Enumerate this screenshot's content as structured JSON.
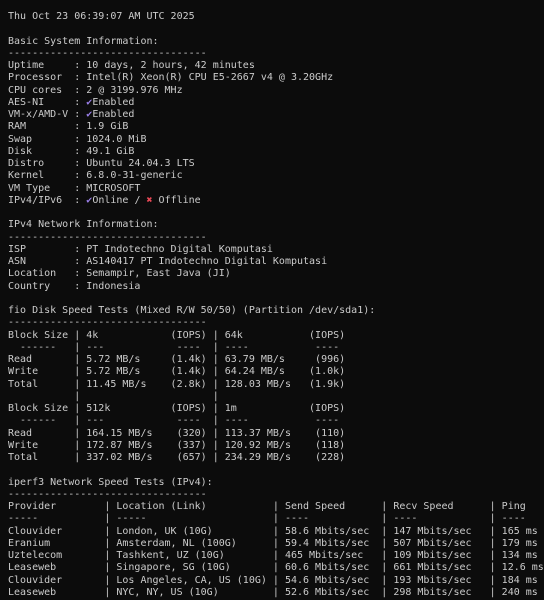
{
  "colors": {
    "background": "#0c0c0c",
    "text": "#cccccc",
    "check": "#9a7fe8",
    "cross": "#e74856"
  },
  "icons": {
    "check": "check-icon",
    "cross": "cross-icon"
  },
  "lines": [
    {
      "text": "Thu Oct 23 06:39:07 AM UTC 2025"
    },
    {
      "text": ""
    },
    {
      "text": "Basic System Information:"
    },
    {
      "text": "---------------------------------"
    },
    {
      "text": "Uptime     : 10 days, 2 hours, 42 minutes"
    },
    {
      "text": "Processor  : Intel(R) Xeon(R) CPU E5-2667 v4 @ 3.20GHz"
    },
    {
      "text": "CPU cores  : 2 @ 3199.976 MHz"
    },
    {
      "segments": [
        {
          "t": "AES-NI     : "
        },
        {
          "icon": "check"
        },
        {
          "t": "Enabled"
        }
      ]
    },
    {
      "segments": [
        {
          "t": "VM-x/AMD-V : "
        },
        {
          "icon": "check"
        },
        {
          "t": "Enabled"
        }
      ]
    },
    {
      "text": "RAM        : 1.9 GiB"
    },
    {
      "text": "Swap       : 1024.0 MiB"
    },
    {
      "text": "Disk       : 49.1 GiB"
    },
    {
      "text": "Distro     : Ubuntu 24.04.3 LTS"
    },
    {
      "text": "Kernel     : 6.8.0-31-generic"
    },
    {
      "text": "VM Type    : MICROSOFT"
    },
    {
      "segments": [
        {
          "t": "IPv4/IPv6  : "
        },
        {
          "icon": "check"
        },
        {
          "t": "Online / "
        },
        {
          "icon": "cross"
        },
        {
          "t": " Offline"
        }
      ]
    },
    {
      "text": ""
    },
    {
      "text": "IPv4 Network Information:"
    },
    {
      "text": "---------------------------------"
    },
    {
      "text": "ISP        : PT Indotechno Digital Komputasi"
    },
    {
      "text": "ASN        : AS140417 PT Indotechno Digital Komputasi"
    },
    {
      "text": "Location   : Semampir, East Java (JI)"
    },
    {
      "text": "Country    : Indonesia"
    },
    {
      "text": ""
    },
    {
      "text": "fio Disk Speed Tests (Mixed R/W 50/50) (Partition /dev/sda1):"
    },
    {
      "text": "---------------------------------"
    },
    {
      "text": "Block Size | 4k            (IOPS) | 64k           (IOPS)"
    },
    {
      "text": "  ------   | ---            ----  | ----           ----"
    },
    {
      "text": "Read       | 5.72 MB/s     (1.4k) | 63.79 MB/s     (996)"
    },
    {
      "text": "Write      | 5.72 MB/s     (1.4k) | 64.24 MB/s    (1.0k)"
    },
    {
      "text": "Total      | 11.45 MB/s    (2.8k) | 128.03 MB/s   (1.9k)"
    },
    {
      "text": "           |                      |"
    },
    {
      "text": "Block Size | 512k          (IOPS) | 1m            (IOPS)"
    },
    {
      "text": "  ------   | ---            ----  | ----           ----"
    },
    {
      "text": "Read       | 164.15 MB/s    (320) | 113.37 MB/s    (110)"
    },
    {
      "text": "Write      | 172.87 MB/s    (337) | 120.92 MB/s    (118)"
    },
    {
      "text": "Total      | 337.02 MB/s    (657) | 234.29 MB/s    (228)"
    },
    {
      "text": ""
    },
    {
      "text": "iperf3 Network Speed Tests (IPv4):"
    },
    {
      "text": "---------------------------------"
    },
    {
      "text": "Provider        | Location (Link)           | Send Speed      | Recv Speed      | Ping"
    },
    {
      "text": "-----           | -----                     | ----            | ----            | ----"
    },
    {
      "text": "Clouvider       | London, UK (10G)          | 58.6 Mbits/sec  | 147 Mbits/sec   | 165 ms"
    },
    {
      "text": "Eranium         | Amsterdam, NL (100G)      | 59.4 Mbits/sec  | 507 Mbits/sec   | 179 ms"
    },
    {
      "text": "Uztelecom       | Tashkent, UZ (10G)        | 465 Mbits/sec   | 109 Mbits/sec   | 134 ms"
    },
    {
      "text": "Leaseweb        | Singapore, SG (10G)       | 60.6 Mbits/sec  | 661 Mbits/sec   | 12.6 ms"
    },
    {
      "text": "Clouvider       | Los Angeles, CA, US (10G) | 54.6 Mbits/sec  | 193 Mbits/sec   | 184 ms"
    },
    {
      "text": "Leaseweb        | NYC, NY, US (10G)         | 52.6 Mbits/sec  | 298 Mbits/sec   | 240 ms"
    }
  ]
}
